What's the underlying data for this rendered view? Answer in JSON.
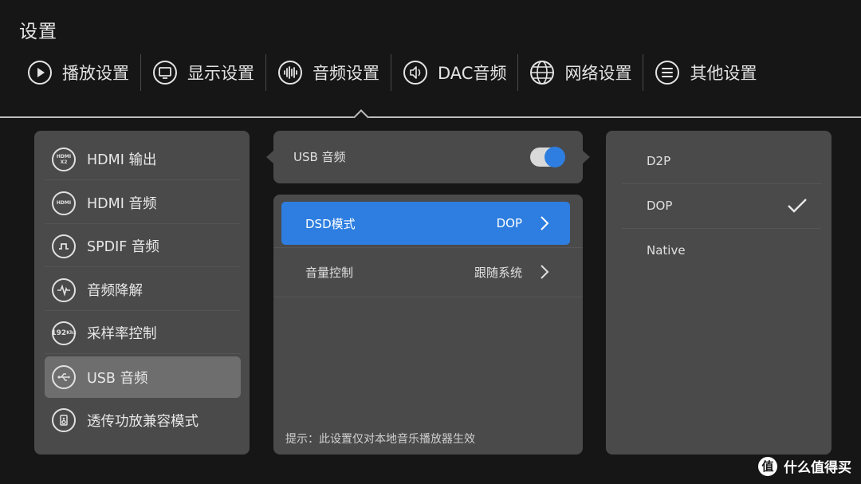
{
  "header": {
    "title": "设置"
  },
  "tabs": [
    {
      "label": "播放设置",
      "icon": "play-icon"
    },
    {
      "label": "显示设置",
      "icon": "monitor-icon"
    },
    {
      "label": "音频设置",
      "icon": "audio-waveform-icon"
    },
    {
      "label": "DAC音频",
      "icon": "speaker-icon"
    },
    {
      "label": "网络设置",
      "icon": "globe-icon"
    },
    {
      "label": "其他设置",
      "icon": "menu-lines-icon"
    }
  ],
  "active_tab": "音频设置",
  "audio_menu": {
    "items": [
      {
        "label": "HDMI 输出",
        "icon": "hdmi-x2-icon",
        "icon_text": "HDMI X2"
      },
      {
        "label": "HDMI 音频",
        "icon": "hdmi-icon",
        "icon_text": "HDMI"
      },
      {
        "label": "SPDIF 音频",
        "icon": "spdif-pulse-icon"
      },
      {
        "label": "音频降解",
        "icon": "waveform-icon"
      },
      {
        "label": "采样率控制",
        "icon": "sample-rate-192khz-icon",
        "icon_text": "192 Khz"
      },
      {
        "label": "USB 音频",
        "icon": "usb-icon",
        "active": true
      },
      {
        "label": "透传功放兼容模式",
        "icon": "amplifier-icon"
      }
    ]
  },
  "usb_audio": {
    "label": "USB 音频",
    "enabled": true,
    "options": [
      {
        "label": "DSD模式",
        "value": "DOP",
        "active": true
      },
      {
        "label": "音量控制",
        "value": "跟随系统",
        "active": false
      }
    ],
    "hint": "提示：此设置仅对本地音乐播放器生效"
  },
  "dsd_mode_choices": {
    "items": [
      {
        "label": "D2P",
        "checked": false
      },
      {
        "label": "DOP",
        "checked": true
      },
      {
        "label": "Native",
        "checked": false
      }
    ]
  },
  "watermark": {
    "logo_char": "值",
    "text": "什么值得买"
  },
  "colors": {
    "background": "#161616",
    "panel": "#4a4a4a",
    "accent_blue": "#2d7ee0",
    "active_menu": "#6e6e6e"
  }
}
